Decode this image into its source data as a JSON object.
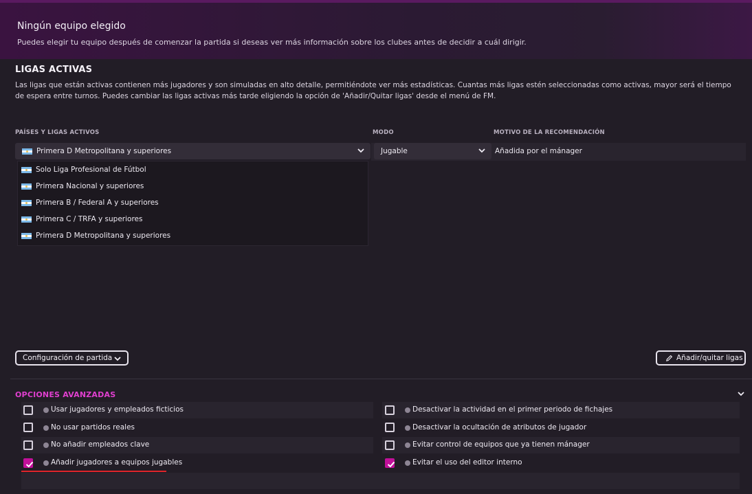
{
  "header": {
    "title": "Ningún equipo elegido",
    "subtitle": "Puedes elegir tu equipo después de comenzar la partida si deseas ver más información sobre los clubes antes de decidir a cuál dirigir."
  },
  "active_leagues": {
    "title": "LIGAS ACTIVAS",
    "description": "Las ligas que están activas contienen más jugadores y son simuladas en alto detalle, permitiéndote ver más estadísticas. Cuantas más ligas estén seleccionadas como activas, mayor será el tiempo de espera entre turnos. Puedes cambiar las ligas activas más tarde eligiendo la opción de 'Añadir/Quitar ligas' desde el menú de FM.",
    "columns": {
      "countries": "PAÍSES Y LIGAS ACTIVOS",
      "mode": "MODO",
      "reason": "MOTIVO DE LA RECOMENDACIÓN"
    },
    "row": {
      "league_selected": "Primera D Metropolitana y superiores",
      "mode_selected": "Jugable",
      "reason": "Añadida por el mánager"
    },
    "dropdown_options": [
      "Solo Liga Profesional de Fútbol",
      "Primera Nacional y superiores",
      "Primera B / Federal A y superiores",
      "Primera C / TRFA y superiores",
      "Primera D Metropolitana y superiores"
    ]
  },
  "buttons": {
    "game_config": "Configuración de partida",
    "add_remove_leagues": "Añadir/quitar ligas"
  },
  "advanced": {
    "title": "OPCIONES AVANZADAS",
    "left": [
      {
        "label": "Usar jugadores y empleados ficticios",
        "checked": false
      },
      {
        "label": "No usar partidos reales",
        "checked": false
      },
      {
        "label": "No añadir empleados clave",
        "checked": false
      },
      {
        "label": "Añadir jugadores a equipos jugables",
        "checked": true
      }
    ],
    "right": [
      {
        "label": "Desactivar la actividad en el primer periodo de fichajes",
        "checked": false
      },
      {
        "label": "Desactivar la ocultación de atributos de jugador",
        "checked": false
      },
      {
        "label": "Evitar control de equipos que ya tienen mánager",
        "checked": false
      },
      {
        "label": "Evitar el uso del editor interno",
        "checked": true
      }
    ]
  },
  "colors": {
    "accent": "#e03fcf",
    "checkbox_on": "#c2109a",
    "underline": "#e0242a"
  }
}
